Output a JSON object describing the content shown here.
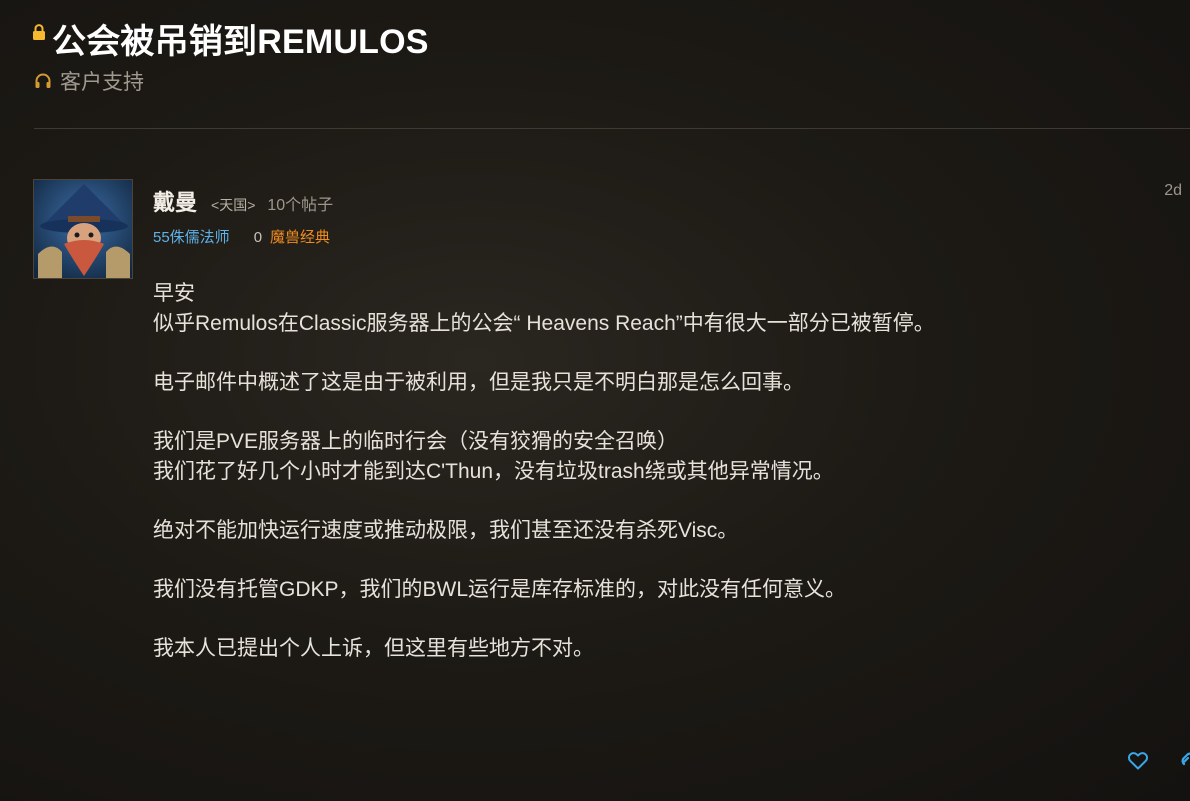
{
  "topic": {
    "title": "公会被吊销到REMULOS",
    "category": "客户支持"
  },
  "post": {
    "author": "戴曼",
    "guild": "<天国>",
    "post_count": "10个帖子",
    "character_class": "55侏儒法师",
    "achievement_points": "0",
    "game": "魔兽经典",
    "timestamp": "2d",
    "body": {
      "p1_line1": "早安",
      "p1_line2": "似乎Remulos在Classic服务器上的公会“ Heavens Reach”中有很大一部分已被暂停。",
      "p2": "电子邮件中概述了这是由于被利用，但是我只是不明白那是怎么回事。",
      "p3_line1": "我们是PVE服务器上的临时行会（没有狡猾的安全召唤）",
      "p3_line2": "我们花了好几个小时才能到达C'Thun，没有垃圾trash绕或其他异常情况。",
      "p4": "绝对不能加快运行速度或推动极限，我们甚至还没有杀死Visc。",
      "p5": "我们没有托管GDKP，我们的BWL运行是库存标准的，对此没有任何意义。",
      "p6": "我本人已提出个人上诉，但这里有些地方不对。"
    }
  },
  "icons": {
    "lock": "lock-icon",
    "category": "headset-icon",
    "like": "heart-icon",
    "link": "link-icon"
  },
  "colors": {
    "class_color": "#5fb2e6",
    "game_color": "#f08b1d",
    "lock_color": "#f5b82e",
    "action_color": "#3aa7e8"
  }
}
